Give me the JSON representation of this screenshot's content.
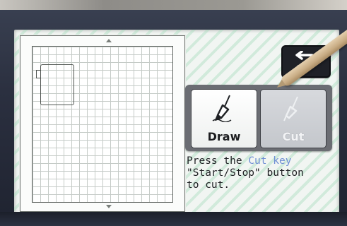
{
  "header": {
    "back_icon": "return-arrow-icon"
  },
  "mat": {
    "scroll_up_icon": "triangle-up-icon",
    "scroll_down_icon": "triangle-down-icon"
  },
  "tools": {
    "draw_label": "Draw",
    "draw_icon": "pen-icon",
    "cut_label": "Cut",
    "cut_icon": "blade-icon"
  },
  "instructions": {
    "line1_prefix": "Press the ",
    "line1_key": "Cut key",
    "line2": "\"Start/Stop\" button",
    "line3": "to cut."
  },
  "colors": {
    "screen_background": "#f1f5f2",
    "stripe": "#a8dcbe",
    "cut_key_text": "#6f8fd4",
    "back_button": "#1f2127"
  }
}
